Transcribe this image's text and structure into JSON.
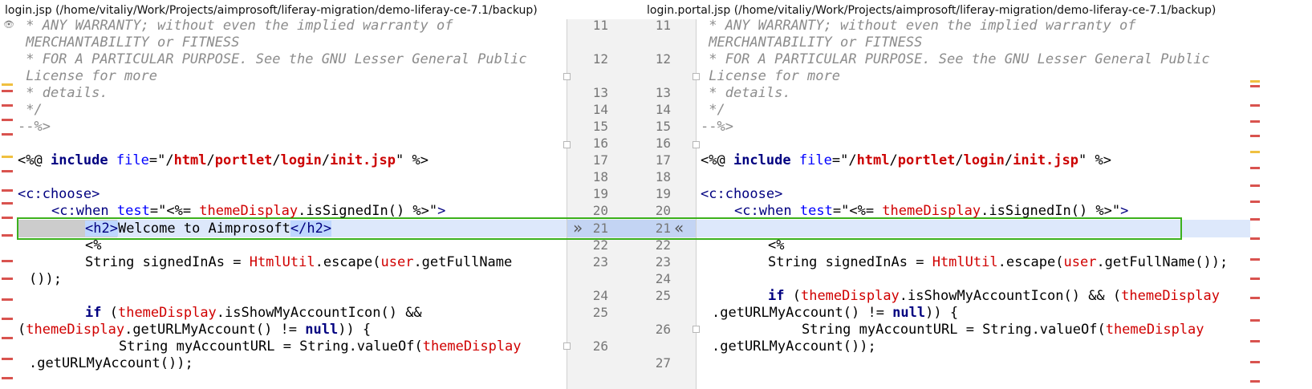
{
  "left": {
    "title": "login.jsp (/home/vitaliy/Work/Projects/aimprosoft/liferay-migration/demo-liferay-ce-7.1/backup)",
    "line_numbers": [
      "11",
      "12",
      "13",
      "14",
      "15",
      "16",
      "17",
      "18",
      "19",
      "20",
      "21",
      "22",
      "23",
      "24",
      "25",
      "26"
    ]
  },
  "right": {
    "title": "login.portal.jsp (/home/vitaliy/Work/Projects/aimprosoft/liferay-migration/demo-liferay-ce-7.1/backup)",
    "line_numbers": [
      "11",
      "12",
      "13",
      "14",
      "15",
      "16",
      "17",
      "18",
      "19",
      "20",
      "21",
      "22",
      "23",
      "24",
      "25",
      "26",
      "27"
    ]
  },
  "tokens": {
    "c1": " * ANY WARRANTY; without even the implied warranty of",
    "c2": " MERCHANTABILITY or FITNESS",
    "c3": " * FOR A PARTICULAR PURPOSE. See the GNU Lesser General Public",
    "c4": " License for more",
    "c5": " * details.",
    "c6": " */",
    "c7": "--%>",
    "dir_open": "<%@ ",
    "include": "include",
    "file": "file",
    "eq": "=",
    "q": "\"",
    "slash": "/",
    "html": "html",
    "portlet": "portlet",
    "login": "login",
    "initjsp": "init.jsp",
    "dir_close": " %>",
    "choose_tag": "<c:choose>",
    "when_open": "<c:when ",
    "test": "test",
    "scr_open": "<%= ",
    "themeDisplay": "themeDisplay",
    "isSignedIn": ".isSignedIn() ",
    "scr_close": "%>",
    "gt": ">",
    "h2_open": "<h2>",
    "welcome": "Welcome to Aimprosoft",
    "h2_close": "</h2>",
    "scriptlet_open": "<%",
    "string_signed": "String signedInAs = ",
    "HtmlUtil": "HtmlUtil",
    "escape": ".escape(",
    "user": "user",
    "getFullName": ".getFullName",
    "getFullName_full": ".getFullName());",
    "paren_end": "());",
    "if_kw": "if",
    "isShowIcon": ".isShowMyAccountIcon() &&",
    "isShowIcon_r": ".isShowMyAccountIcon() && (",
    "open_paren": " (",
    "open_paren_only": "(",
    "getURL": ".getURLMyAccount() != ",
    "null": "null",
    "close_brace": ")) {",
    "string_myurl": "String myAccountURL = String.valueOf(",
    "getURLend": ".getURLMyAccount());"
  },
  "colors": {
    "accent_highlight": "#dde8fb",
    "diff_box": "#3cb11d",
    "change_marker": "#d9534f"
  },
  "icons": {
    "merge_right": "»",
    "merge_left": "«"
  }
}
